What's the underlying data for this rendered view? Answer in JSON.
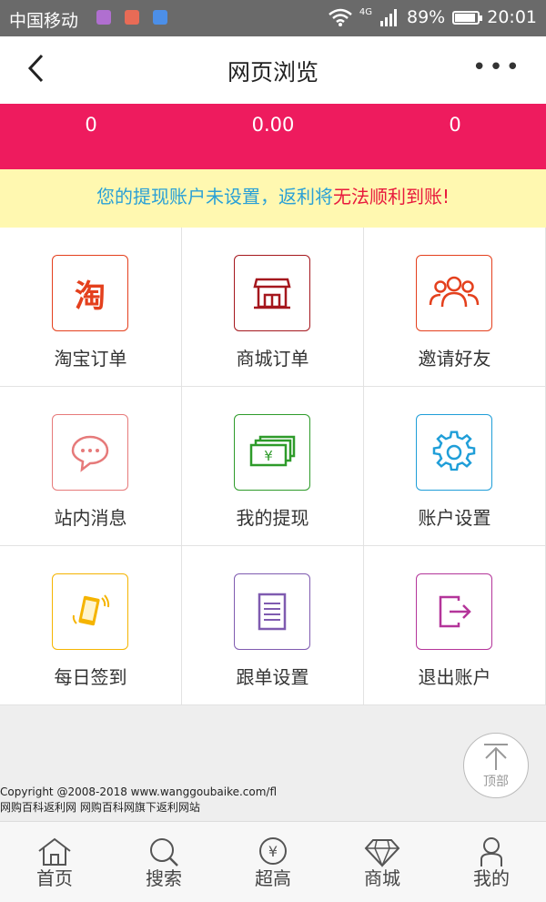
{
  "status_bar": {
    "carrier": "中国移动",
    "network": "4G",
    "battery": "89%",
    "battery_level": 0.89,
    "time": "20:01"
  },
  "header": {
    "title": "网页浏览"
  },
  "stats": [
    {
      "value": "0"
    },
    {
      "value": "0.00"
    },
    {
      "value": "0"
    }
  ],
  "notice": {
    "part1": "您的提现账户未设置，返利将",
    "part2": "无法顺利到账!"
  },
  "grid": [
    {
      "label": "淘宝订单",
      "icon": "taobao-icon",
      "color": "#e4401d",
      "glyph": "淘"
    },
    {
      "label": "商城订单",
      "icon": "store-icon",
      "color": "#a5171d"
    },
    {
      "label": "邀请好友",
      "icon": "friends-icon",
      "color": "#e4401d"
    },
    {
      "label": "站内消息",
      "icon": "message-icon",
      "color": "#e67a7a"
    },
    {
      "label": "我的提现",
      "icon": "money-icon",
      "color": "#2e9b2a",
      "glyph": "¥"
    },
    {
      "label": "账户设置",
      "icon": "gear-icon",
      "color": "#1f9ed8"
    },
    {
      "label": "每日签到",
      "icon": "phone-checkin-icon",
      "color": "#f5b400"
    },
    {
      "label": "跟单设置",
      "icon": "document-icon",
      "color": "#7f5bb0"
    },
    {
      "label": "退出账户",
      "icon": "logout-icon",
      "color": "#b4359a"
    }
  ],
  "footer": {
    "line1": "Copyright @2008-2018  www.wanggoubaike.com/fl",
    "line2": "网购百科返利网  网购百科网旗下返利网站"
  },
  "totop": {
    "label": "顶部"
  },
  "tabs": [
    {
      "label": "首页",
      "icon": "home-icon"
    },
    {
      "label": "搜索",
      "icon": "search-icon"
    },
    {
      "label": "超高",
      "icon": "yen-coin-icon",
      "glyph": "¥"
    },
    {
      "label": "商城",
      "icon": "diamond-icon"
    },
    {
      "label": "我的",
      "icon": "user-icon"
    }
  ]
}
